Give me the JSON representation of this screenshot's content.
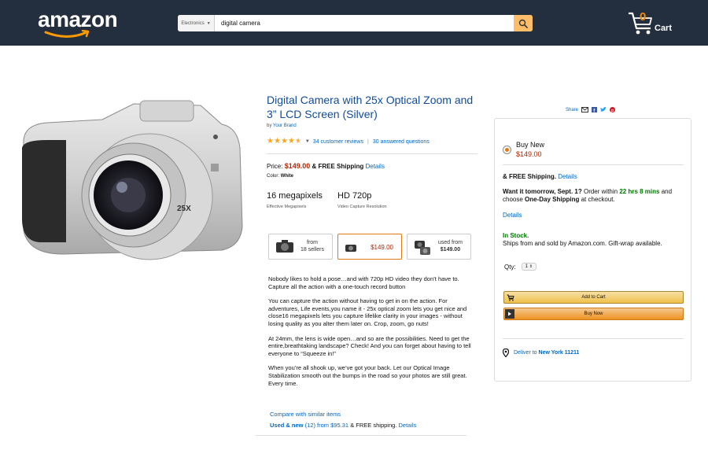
{
  "header": {
    "logo_text": "amazon",
    "search": {
      "category": "Electronics",
      "query": "digital camera"
    },
    "cart": {
      "count": "0",
      "label": "Cart"
    }
  },
  "product": {
    "title": "Digital Camera with 25x Optical Zoom and 3” LCD Screen (Silver)",
    "by_prefix": "by",
    "brand": "Your Brand",
    "rating_stars": 4.5,
    "reviews_link": "34 customer reviews",
    "questions_link": "30 answered questions",
    "price_label": "Price:",
    "price": "$149.00",
    "shipping": "& FREE Shipping",
    "details_link": "Details",
    "color_label": "Color:",
    "color_value": "White",
    "specs": [
      {
        "value": "16 megapixels",
        "label": "Effective Megapixels"
      },
      {
        "value": "HD 720p",
        "label": "Video Capture Resolution"
      }
    ],
    "options": [
      {
        "line1": "from",
        "line2": "18 sellers"
      },
      {
        "price": "$149.00"
      },
      {
        "line1": "used from",
        "line2": "$149.00"
      }
    ],
    "bullets": [
      "Nobody likes to hold a pose…and with 720p HD video they don’t have to. Capture all the action with a one-touch record button",
      "You can capture the action without having to get in on the action. For adventures, Life events,you name it - 25x optical zoom lets you get nice and close16 megapixels lets you capture lifelike clarity in your images - without losing quality as you alter them later on. Crop, zoom, go nuts!",
      "At 24mm, the lens is wide open…and so are the possibilities. Need to get the entire,breathtaking landscape? Check! And you can forget about having to tell everyone to “Squeeze in!”",
      "When you’re all shook up, we’ve got your back. Let our Optical Image Stabilization smooth out the bumps in the road so your photos are still great. Every time."
    ],
    "compare_link": "Compare with similar items",
    "used_new_link": "Used & new",
    "used_new_count": "(12)",
    "used_new_from": "from",
    "used_new_price": "$95.31",
    "used_new_shipping": "& FREE shipping.",
    "used_new_details": "Details"
  },
  "share_label": "Share",
  "buybox": {
    "buy_new": "Buy New",
    "price": "$149.00",
    "free_shipping": "& FREE Shipping.",
    "details_link": "Details",
    "want_it": "Want it tomorrow, Sept. 1?",
    "order_within": " Order within ",
    "countdown": "22 hrs 8 mins",
    "and_choose": " and choose ",
    "one_day": "One-Day Shipping",
    "at_checkout": " at checkout.",
    "details_link2": "Details",
    "in_stock": "In Stock.",
    "ships_from": "Ships from and sold by Amazon.com. Gift-wrap available.",
    "qty_label": "Qty:",
    "qty_value": "1",
    "add_to_cart": "Add to Cart",
    "buy_now": "Buy Now",
    "deliver_to": "Deliver to",
    "deliver_location": "New York 11211"
  },
  "colors": {
    "header": "#232f3e",
    "link": "#0066c0",
    "price": "#b12704",
    "accent": "#febd69",
    "stock": "#007600"
  }
}
